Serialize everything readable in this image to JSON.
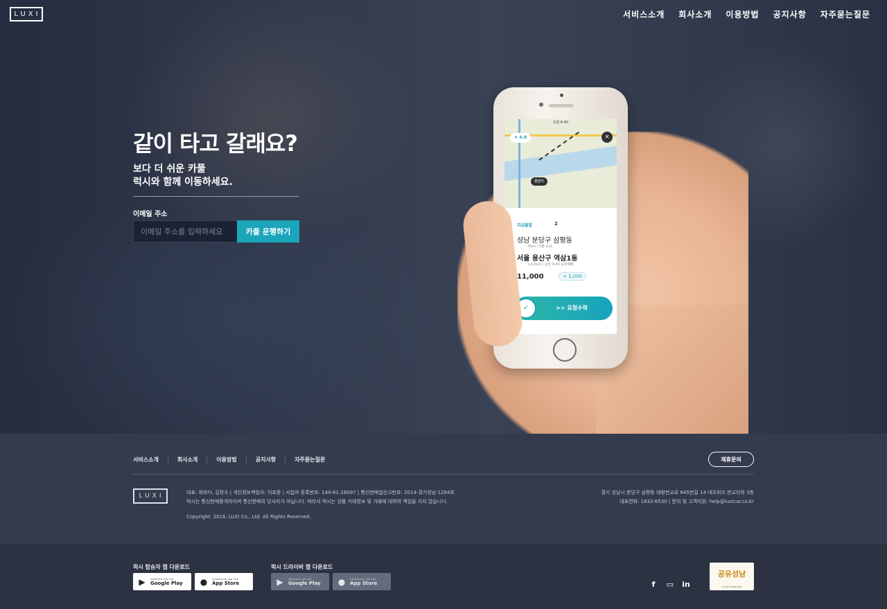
{
  "header": {
    "logo": "LUXI",
    "nav": [
      "서비스소개",
      "회사소개",
      "이용방법",
      "공지사항",
      "자주묻는질문"
    ]
  },
  "hero": {
    "headline": "같이 타고 갈래요?",
    "subline1": "보다 더 쉬운 카풀",
    "subline2": "럭시와 함께 이동하세요.",
    "email_label": "이메일 주소",
    "email_placeholder": "이메일 주소를 입력하세요",
    "cta_label": "카풀 운행하기"
  },
  "phone_app": {
    "status_time": "오전 6:40",
    "rating": "★ 4.8",
    "pin": "출발지",
    "ride_label": "지금출발",
    "passengers": "2",
    "from": "성남 분당구 삼평동",
    "from_detail": "40m / 5분 소요",
    "to": "서울 용산구 역삼1동",
    "to_detail": "14.2km / 오전 9:40 도착예정",
    "price": "11,000",
    "price_plus": "+ 1,000",
    "swipe_label": ">> 요청수락"
  },
  "footer": {
    "nav": [
      "서비스소개",
      "회사소개",
      "이용방법",
      "공지사항",
      "자주묻는질문"
    ],
    "partner_button": "제휴문의",
    "logo": "LUXI",
    "info_line1": "대표: 최바다, 김정수 | 개인정보책임자: 이효종 | 사업자 등록번호: 144-81-28097 | 통신판매업신고번호: 2014-경기성남-1264호",
    "info_line2": "럭시는 통신판매중개자이며 통신판매의 당사자가 아닙니다. 따라서 럭시는 상품 거래정보 및 거래에 대하여 책임을 지지 않습니다.",
    "copyright": "Copyright. 2016. LUXI Co., Ltd. All Rights Reserved.",
    "address_line1": "경기 성남시 분당구 삼평동 대왕판교로 645번길 14 네오위즈 판교타워 3층",
    "address_line2": "대표전화: 1833-6530 | 문의 및 고객지원: help@luxicar.co.kr"
  },
  "downloads": {
    "passenger_label": "럭시 탑승자 앱 다운로드",
    "driver_label": "럭시 드라이버 앱 다운로드",
    "google_small": "ANDROID APP ON",
    "google_big": "Google Play",
    "apple_small": "DOWNLOAD ON THE",
    "apple_big": "App Store",
    "social": [
      "facebook-icon",
      "chat-icon",
      "linkedin-icon"
    ],
    "badge_text": "공유성남",
    "badge_sub": "SHARE SEONGNAM"
  }
}
